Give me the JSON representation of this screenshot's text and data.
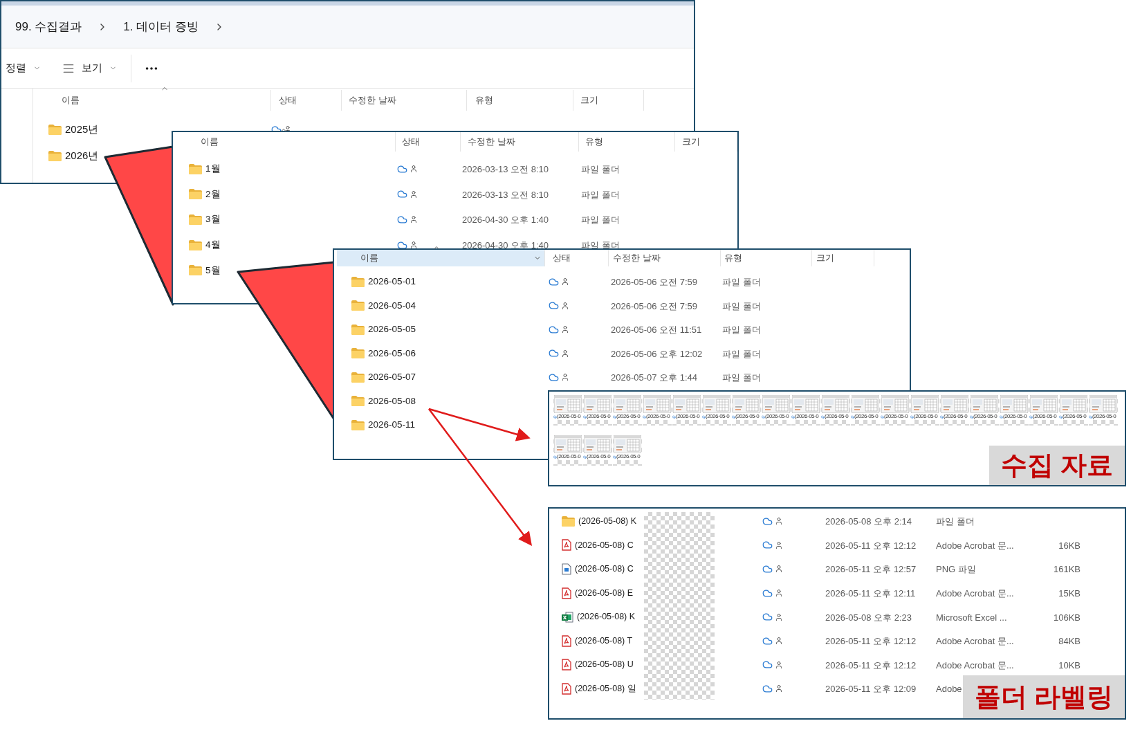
{
  "main_window": {
    "breadcrumb": [
      "99. 수집결과",
      "1. 데이터 증빙"
    ],
    "toolbar": [
      {
        "kind": "sort",
        "label": "정렬"
      },
      {
        "kind": "view",
        "label": "보기"
      }
    ],
    "columns": [
      "이름",
      "상태",
      "수정한 날짜",
      "유형",
      "크기"
    ],
    "rows": [
      {
        "kind": "folder",
        "name": "2025년",
        "synced": true
      },
      {
        "kind": "folder",
        "name": "2026년"
      }
    ]
  },
  "month_window": {
    "columns": [
      "이름",
      "상태",
      "수정한 날짜",
      "유형",
      "크기"
    ],
    "rows": [
      {
        "kind": "folder",
        "name": "1월",
        "date": "2026-03-13 오전 8:10",
        "type": "파일 폴더"
      },
      {
        "kind": "folder",
        "name": "2월",
        "date": "2026-03-13 오전 8:10",
        "type": "파일 폴더"
      },
      {
        "kind": "folder",
        "name": "3월",
        "date": "2026-04-30 오후 1:40",
        "type": "파일 폴더"
      },
      {
        "kind": "folder",
        "name": "4월",
        "date": "2026-04-30 오후 1:40",
        "type": "파일 폴더"
      },
      {
        "kind": "folder",
        "name": "5월"
      }
    ]
  },
  "day_window": {
    "columns": [
      {
        "label": "이름",
        "selected": true
      },
      {
        "label": "상태",
        "selected": false
      },
      {
        "label": "수정한 날짜",
        "selected": false
      },
      {
        "label": "유형",
        "selected": false
      },
      {
        "label": "크기",
        "selected": false
      }
    ],
    "rows": [
      {
        "kind": "folder",
        "name": "2026-05-01",
        "date": "2026-05-06 오전 7:59",
        "type": "파일 폴더"
      },
      {
        "kind": "folder",
        "name": "2026-05-04",
        "date": "2026-05-06 오전 7:59",
        "type": "파일 폴더"
      },
      {
        "kind": "folder",
        "name": "2026-05-05",
        "date": "2026-05-06 오전 11:51",
        "type": "파일 폴더"
      },
      {
        "kind": "folder",
        "name": "2026-05-06",
        "date": "2026-05-06 오후 12:02",
        "type": "파일 폴더"
      },
      {
        "kind": "folder",
        "name": "2026-05-07",
        "date": "2026-05-07 오후 1:44",
        "type": "파일 폴더"
      },
      {
        "kind": "folder",
        "name": "2026-05-08"
      },
      {
        "kind": "folder",
        "name": "2026-05-11"
      }
    ]
  },
  "thumbnail_window": {
    "thumbnails": [
      {
        "caption": "(2026-05-0"
      },
      {
        "caption": "(2026-05-0"
      },
      {
        "caption": "(2026-05-0"
      },
      {
        "caption": "(2026-05-0"
      },
      {
        "caption": "(2026-05-0"
      },
      {
        "caption": "(2026-05-0"
      },
      {
        "caption": "(2026-05-0"
      },
      {
        "caption": "(2026-05-0"
      },
      {
        "caption": "(2026-05-0"
      },
      {
        "caption": "(2026-05-0"
      },
      {
        "caption": "(2026-05-0"
      },
      {
        "caption": "(2026-05-0"
      },
      {
        "caption": "(2026-05-0"
      },
      {
        "caption": "(2026-05-0"
      },
      {
        "caption": "(2026-05-0"
      },
      {
        "caption": "(2026-05-0"
      },
      {
        "caption": "(2026-05-0"
      },
      {
        "caption": "(2026-05-0"
      },
      {
        "caption": "(2026-05-0"
      },
      {
        "caption": "(2026-05-0"
      },
      {
        "caption": "(2026-05-0"
      },
      {
        "caption": "(2026-05-0"
      }
    ],
    "label": "수집 자료"
  },
  "file_window": {
    "rows": [
      {
        "kind": "folder",
        "name": "(2026-05-08) K",
        "date": "2026-05-08 오후 2:14",
        "type": "파일 폴더"
      },
      {
        "kind": "pdf",
        "name": "(2026-05-08) C",
        "date": "2026-05-11 오후 12:12",
        "type": "Adobe Acrobat 문...",
        "size": "16KB"
      },
      {
        "kind": "png",
        "name": "(2026-05-08) C",
        "date": "2026-05-11 오후 12:57",
        "type": "PNG 파일",
        "size": "161KB"
      },
      {
        "kind": "pdf",
        "name": "(2026-05-08) E",
        "date": "2026-05-11 오후 12:11",
        "type": "Adobe Acrobat 문...",
        "size": "15KB"
      },
      {
        "kind": "excel",
        "name": "(2026-05-08) K",
        "date": "2026-05-08 오후 2:23",
        "type": "Microsoft Excel ...",
        "size": "106KB"
      },
      {
        "kind": "pdf",
        "name": "(2026-05-08) T",
        "date": "2026-05-11 오후 12:12",
        "type": "Adobe Acrobat 문...",
        "size": "84KB"
      },
      {
        "kind": "pdf",
        "name": "(2026-05-08) U",
        "date": "2026-05-11 오후 12:12",
        "type": "Adobe Acrobat 문...",
        "size": "10KB"
      },
      {
        "kind": "pdf",
        "name": "(2026-05-08) 일",
        "date": "2026-05-11 오후 12:09",
        "type": "Adobe"
      }
    ],
    "label": "폴더 라벨링"
  }
}
